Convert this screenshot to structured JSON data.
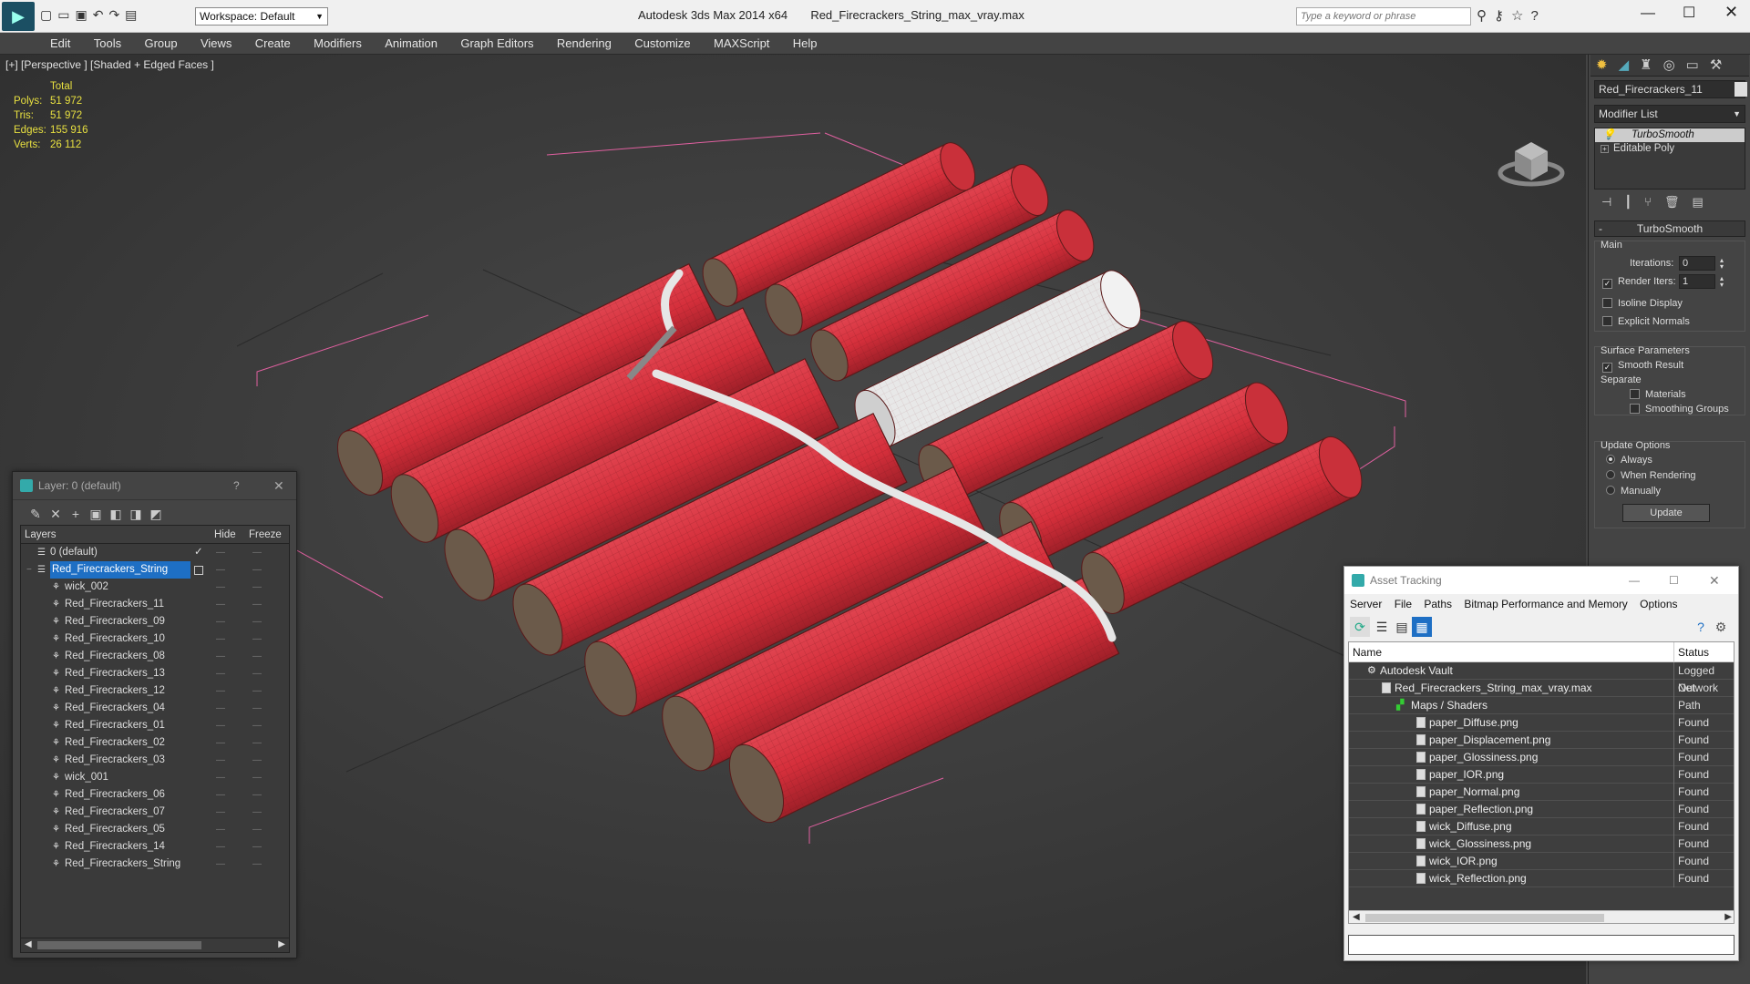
{
  "window": {
    "app_title": "Autodesk 3ds Max  2014 x64",
    "file_title": "Red_Firecrackers_String_max_vray.max",
    "workspace": "Workspace: Default",
    "search_placeholder": "Type a keyword or phrase"
  },
  "menu": [
    "Edit",
    "Tools",
    "Group",
    "Views",
    "Create",
    "Modifiers",
    "Animation",
    "Graph Editors",
    "Rendering",
    "Customize",
    "MAXScript",
    "Help"
  ],
  "viewport": {
    "label": "[+] [Perspective ] [Shaded + Edged Faces ]",
    "stats": {
      "header": "Total",
      "rows": [
        {
          "label": "Polys:",
          "value": "51 972"
        },
        {
          "label": "Tris:",
          "value": "51 972"
        },
        {
          "label": "Edges:",
          "value": "155 916"
        },
        {
          "label": "Verts:",
          "value": "26 112"
        }
      ]
    }
  },
  "command_panel": {
    "object_name": "Red_Firecrackers_11",
    "modifier_list": "Modifier List",
    "stack": [
      "TurboSmooth",
      "Editable Poly"
    ],
    "rollout_title": "TurboSmooth",
    "main_group": "Main",
    "iterations_label": "Iterations:",
    "iterations_value": "0",
    "render_iters_label": "Render Iters:",
    "render_iters_value": "1",
    "isoline": "Isoline Display",
    "explicit_normals": "Explicit Normals",
    "surface_group": "Surface Parameters",
    "smooth_result": "Smooth Result",
    "separate": "Separate",
    "materials": "Materials",
    "smoothing_groups": "Smoothing Groups",
    "update_group": "Update Options",
    "always": "Always",
    "when_rendering": "When Rendering",
    "manually": "Manually",
    "update_button": "Update"
  },
  "layer_window": {
    "title": "Layer: 0 (default)",
    "help": "?",
    "col_layers": "Layers",
    "col_hide": "Hide",
    "col_freeze": "Freeze",
    "rows": [
      {
        "name": "0 (default)",
        "level": 0,
        "checked": true
      },
      {
        "name": "Red_Firecrackers_String",
        "level": 0,
        "selected": true
      },
      {
        "name": "wick_002",
        "level": 1
      },
      {
        "name": "Red_Firecrackers_11",
        "level": 1
      },
      {
        "name": "Red_Firecrackers_09",
        "level": 1
      },
      {
        "name": "Red_Firecrackers_10",
        "level": 1
      },
      {
        "name": "Red_Firecrackers_08",
        "level": 1
      },
      {
        "name": "Red_Firecrackers_13",
        "level": 1
      },
      {
        "name": "Red_Firecrackers_12",
        "level": 1
      },
      {
        "name": "Red_Firecrackers_04",
        "level": 1
      },
      {
        "name": "Red_Firecrackers_01",
        "level": 1
      },
      {
        "name": "Red_Firecrackers_02",
        "level": 1
      },
      {
        "name": "Red_Firecrackers_03",
        "level": 1
      },
      {
        "name": "wick_001",
        "level": 1
      },
      {
        "name": "Red_Firecrackers_06",
        "level": 1
      },
      {
        "name": "Red_Firecrackers_07",
        "level": 1
      },
      {
        "name": "Red_Firecrackers_05",
        "level": 1
      },
      {
        "name": "Red_Firecrackers_14",
        "level": 1
      },
      {
        "name": "Red_Firecrackers_String",
        "level": 1
      }
    ]
  },
  "asset_tracking": {
    "title": "Asset Tracking",
    "menu": [
      "Server",
      "File",
      "Paths",
      "Bitmap Performance and Memory",
      "Options"
    ],
    "col_name": "Name",
    "col_status": "Status",
    "rows": [
      {
        "name": "Autodesk Vault",
        "status": "Logged Out",
        "level": 0
      },
      {
        "name": "Red_Firecrackers_String_max_vray.max",
        "status": "Network Path",
        "level": 1
      },
      {
        "name": "Maps / Shaders",
        "status": "",
        "level": 2
      },
      {
        "name": "paper_Diffuse.png",
        "status": "Found",
        "level": 3
      },
      {
        "name": "paper_Displacement.png",
        "status": "Found",
        "level": 3
      },
      {
        "name": "paper_Glossiness.png",
        "status": "Found",
        "level": 3
      },
      {
        "name": "paper_IOR.png",
        "status": "Found",
        "level": 3
      },
      {
        "name": "paper_Normal.png",
        "status": "Found",
        "level": 3
      },
      {
        "name": "paper_Reflection.png",
        "status": "Found",
        "level": 3
      },
      {
        "name": "wick_Diffuse.png",
        "status": "Found",
        "level": 3
      },
      {
        "name": "wick_Glossiness.png",
        "status": "Found",
        "level": 3
      },
      {
        "name": "wick_IOR.png",
        "status": "Found",
        "level": 3
      },
      {
        "name": "wick_Reflection.png",
        "status": "Found",
        "level": 3
      }
    ]
  },
  "colors": {
    "accent": "#1e6fc4",
    "firecracker": "#d8323e",
    "stats_text": "#e8e040",
    "selection_bracket": "#e060a0"
  }
}
